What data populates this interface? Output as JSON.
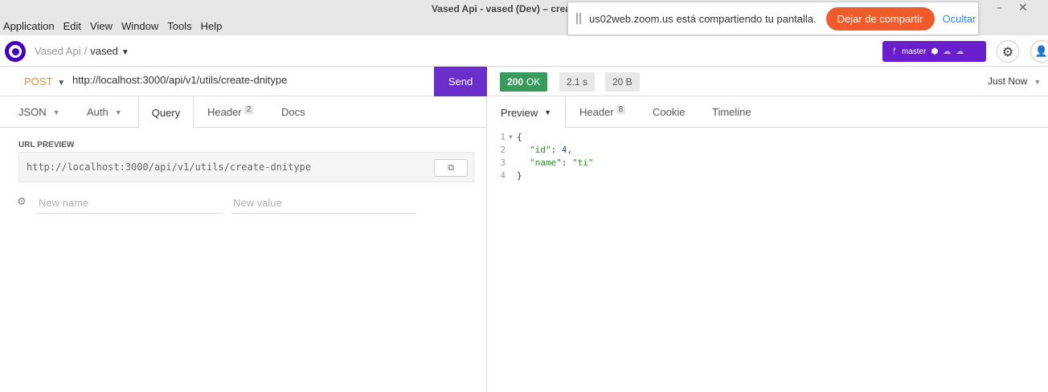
{
  "window": {
    "title": "Vased Api - vased (Dev) – createDniType",
    "menu": [
      "Application",
      "Edit",
      "View",
      "Window",
      "Tools",
      "Help"
    ]
  },
  "zoom_banner": {
    "message": "us02web.zoom.us está compartiendo tu pantalla.",
    "stop_label": "Dejar de compartir",
    "hide_label": "Ocultar",
    "stop_color": "#ef5b2b"
  },
  "header": {
    "project": "Vased Api",
    "separator": "/",
    "workspace": "vased",
    "branch": "master",
    "accent_color": "#6a1fcf"
  },
  "request": {
    "method": "POST",
    "url": "http://localhost:3000/api/v1/utils/create-dnitype",
    "send_label": "Send",
    "tabs": [
      {
        "label": "JSON",
        "dropdown": true
      },
      {
        "label": "Auth",
        "dropdown": true
      },
      {
        "label": "Query",
        "active": true
      },
      {
        "label": "Header",
        "badge": "2"
      },
      {
        "label": "Docs"
      }
    ],
    "url_preview_label": "URL PREVIEW",
    "url_preview": "http://localhost:3000/api/v1/utils/create-dnitype",
    "param_name_placeholder": "New name",
    "param_value_placeholder": "New value"
  },
  "response": {
    "status_code": "200",
    "status_text": "OK",
    "status_color": "#3a9a5b",
    "time": "2.1 s",
    "size": "20 B",
    "history": "Just Now",
    "tabs": [
      {
        "label": "Preview",
        "active": true,
        "dropdown": true
      },
      {
        "label": "Header",
        "badge": "8"
      },
      {
        "label": "Cookie"
      },
      {
        "label": "Timeline"
      }
    ],
    "body_lines": [
      {
        "n": "1",
        "text": "{"
      },
      {
        "n": "2",
        "key": "\"id\"",
        "value": "4,"
      },
      {
        "n": "3",
        "key": "\"name\"",
        "value": "\"ti\""
      },
      {
        "n": "4",
        "text": "}"
      }
    ]
  }
}
